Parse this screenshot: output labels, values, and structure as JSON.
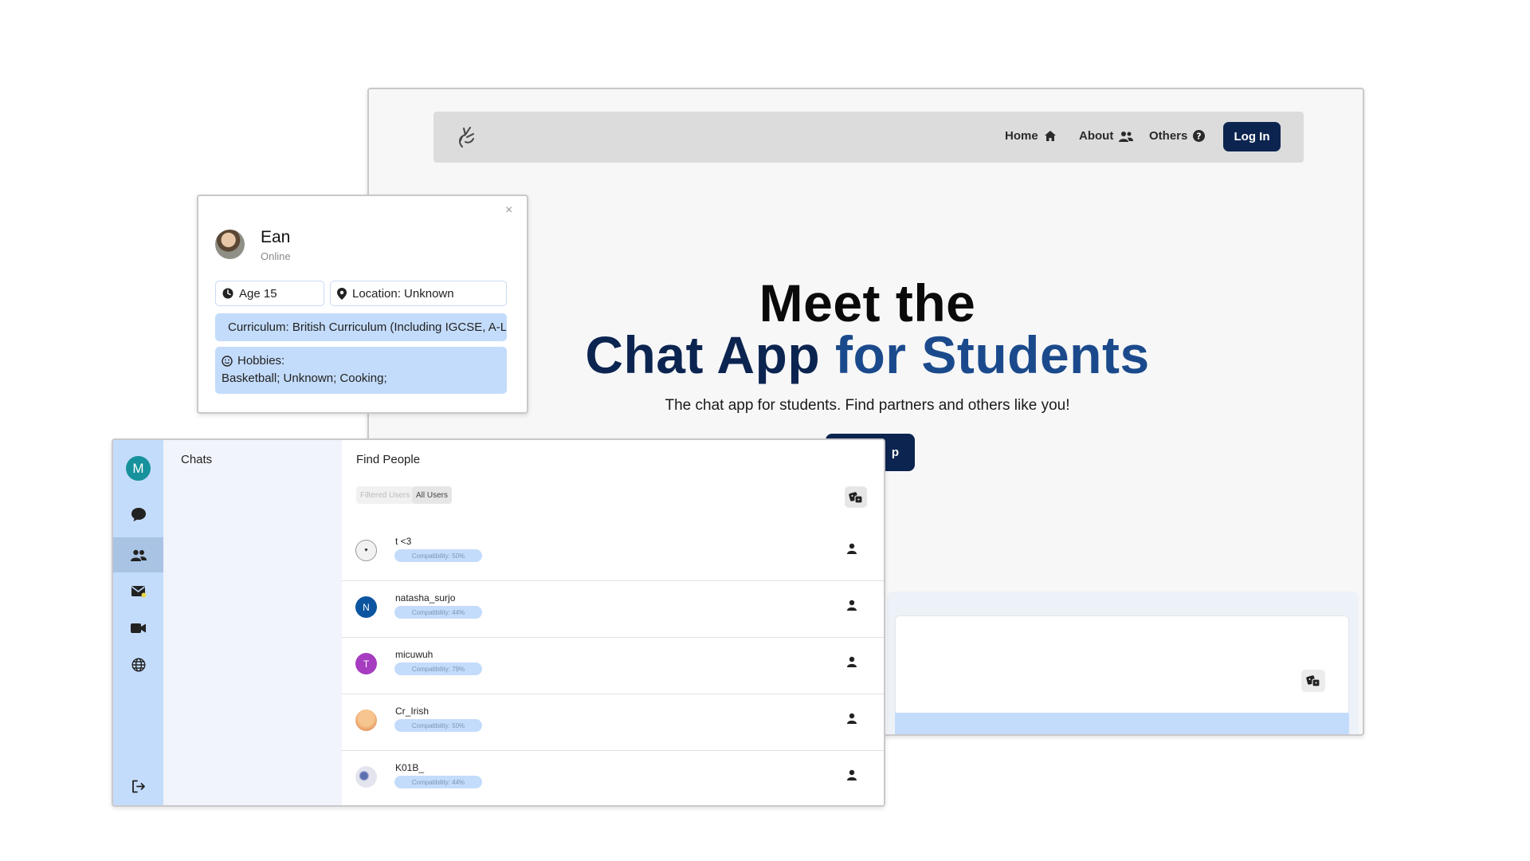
{
  "landing": {
    "nav": {
      "home": "Home",
      "about": "About",
      "others": "Others",
      "login": "Log In"
    },
    "hero": {
      "line1": "Meet the",
      "line2_part1": "Chat App",
      "line2_part2": "for",
      "line2_part3": "Students",
      "subtitle": "The chat app for students. Find partners and others like you!",
      "cta_visible_text": "p"
    },
    "icons": [
      "peace-hand-logo-icon",
      "home-icon",
      "users-icon",
      "question-circle-icon",
      "dice-icon"
    ]
  },
  "profile": {
    "close": "×",
    "name": "Ean",
    "status": "Online",
    "age": "Age 15",
    "location": "Location: Unknown",
    "curriculum": "Curriculum: British Curriculum (Including IGCSE, A-Levels)",
    "hobbies_label": "Hobbies:",
    "hobbies": "Basketball;  Unknown;  Cooking;"
  },
  "chatapp": {
    "user_initial": "M",
    "chats_title": "Chats",
    "people_title": "Find People",
    "tabs": {
      "filtered": "Filtered Users",
      "all": "All Users"
    },
    "rail_icons": [
      "chat-bubble-icon",
      "people-icon",
      "mail-icon",
      "video-icon",
      "globe-icon",
      "logout-icon"
    ],
    "people": [
      {
        "name": "t <3",
        "compat": "Compatibility: 50%",
        "avatar": "",
        "color": "#f2f2f2"
      },
      {
        "name": "natasha_surjo",
        "compat": "Compatibility: 44%",
        "avatar": "N",
        "color": "#0b55a0"
      },
      {
        "name": "micuwuh",
        "compat": "Compatibility: 79%",
        "avatar": "T",
        "color": "#a63cc0"
      },
      {
        "name": "Cr_Irish",
        "compat": "Compatibility: 50%",
        "avatar": "",
        "color": "#f2b982"
      },
      {
        "name": "K01B_",
        "compat": "Compatibility: 44%",
        "avatar": "",
        "color": "#e4e4ee"
      }
    ]
  }
}
